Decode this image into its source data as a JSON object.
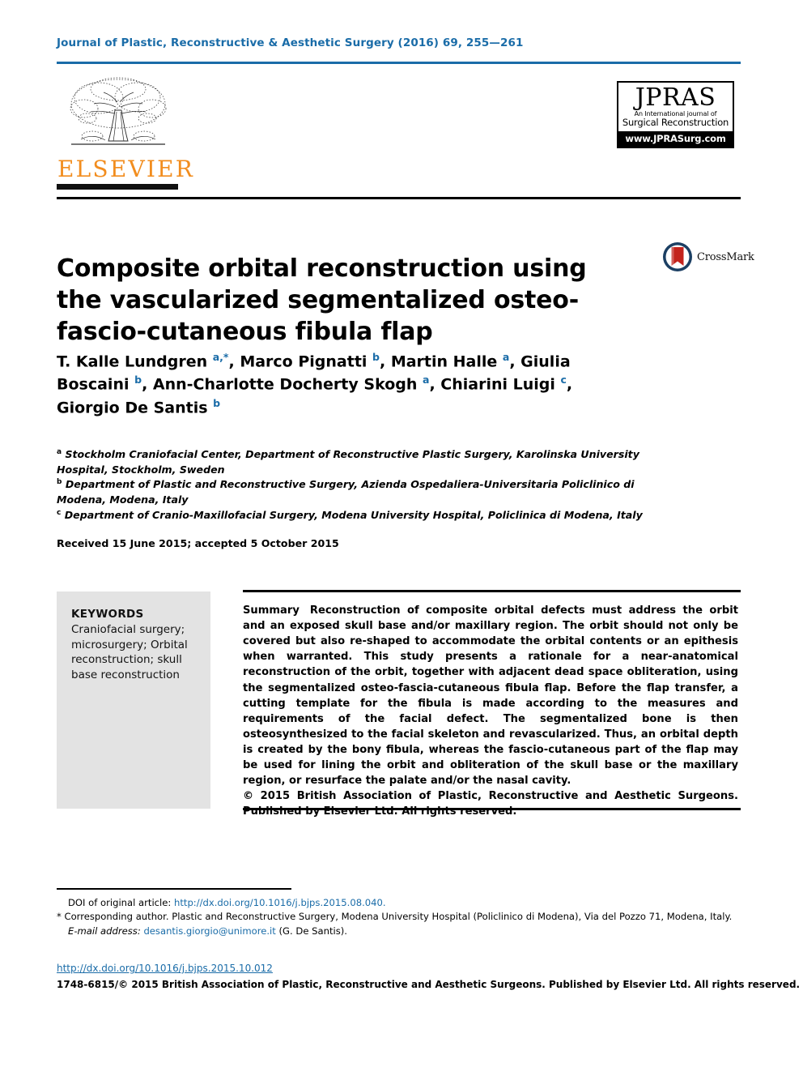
{
  "journal": {
    "citation_line": "Journal of Plastic, Reconstructive & Aesthetic Surgery (2016) 69, 255—261",
    "accent_color": "#1a6ca8"
  },
  "publisher_logo": {
    "wordmark": "ELSEVIER",
    "wordmark_color": "#f28d1e",
    "icon": "elsevier-tree-icon"
  },
  "journal_logo": {
    "acronym": "JPRAS",
    "subtitle_line1": "An International journal of",
    "subtitle_line2": "Surgical Reconstruction",
    "url": "www.JPRASurg.com"
  },
  "crossmark": {
    "label": "CrossMark",
    "icon": "crossmark-icon"
  },
  "article": {
    "title": "Composite orbital reconstruction using the vascularized segmentalized osteo-fascio-cutaneous fibula flap",
    "authors_html": "T. Kalle Lundgren <sup class=\"aff-mark\">a,*</sup>, Marco Pignatti <sup class=\"aff-mark\">b</sup>, Martin Halle <sup class=\"aff-mark\">a</sup>, Giulia Boscaini <sup class=\"aff-mark\">b</sup>, Ann-Charlotte Docherty Skogh <sup class=\"aff-mark\">a</sup>, Chiarini Luigi <sup class=\"aff-mark\">c</sup>, Giorgio De Santis <sup class=\"aff-mark\">b</sup>",
    "affiliations_html": "<span class=\"aff-sup\">a</span> Stockholm Craniofacial Center, Department of Reconstructive Plastic Surgery, Karolinska University Hospital, Stockholm, Sweden<br><span class=\"aff-sup\">b</span> Department of Plastic and Reconstructive Surgery, Azienda Ospedaliera-Universitaria Policlinico di Modena, Modena, Italy<br><span class=\"aff-sup\">c</span> Department of Cranio-Maxillofacial Surgery, Modena University Hospital, Policlinica di Modena, Italy",
    "history": "Received 15 June 2015; accepted 5 October 2015"
  },
  "keywords": {
    "heading": "KEYWORDS",
    "text": "Craniofacial surgery; microsurgery; Orbital reconstruction; skull base reconstruction"
  },
  "abstract": {
    "label": "Summary",
    "body": "Reconstruction of composite orbital defects must address the orbit and an exposed skull base and/or maxillary region. The orbit should not only be covered but also re-shaped to accommodate the orbital contents or an epithesis when warranted. This study presents a rationale for a near-anatomical reconstruction of the orbit, together with adjacent dead space obliteration, using the segmentalized osteo-fascia-cutaneous fibula flap. Before the flap transfer, a cutting template for the fibula is made according to the measures and requirements of the facial defect. The segmentalized bone is then osteosynthesized to the facial skeleton and revascularized. Thus, an orbital depth is created by the bony fibula, whereas the fascio-cutaneous part of the flap may be used for lining the orbit and obliteration of the skull base or the maxillary region, or resurface the palate and/or the nasal cavity.",
    "copyright": "© 2015 British Association of Plastic, Reconstructive and Aesthetic Surgeons. Published by Elsevier Ltd. All rights reserved."
  },
  "footnotes": {
    "doi_original_label": "DOI of original article:",
    "doi_original_url": "http://dx.doi.org/10.1016/j.bjps.2015.08.040.",
    "corresponding": "* Corresponding author. Plastic and Reconstructive Surgery, Modena University Hospital (Policlinico di Modena), Via del Pozzo 71, Modena, Italy.",
    "email_label": "E-mail address:",
    "email": "desantis.giorgio@unimore.it",
    "email_suffix": "(G. De Santis)."
  },
  "bottom": {
    "doi": "http://dx.doi.org/10.1016/j.bjps.2015.10.012",
    "copyright": "1748-6815/© 2015 British Association of Plastic, Reconstructive and Aesthetic Surgeons. Published by Elsevier Ltd. All rights reserved."
  }
}
